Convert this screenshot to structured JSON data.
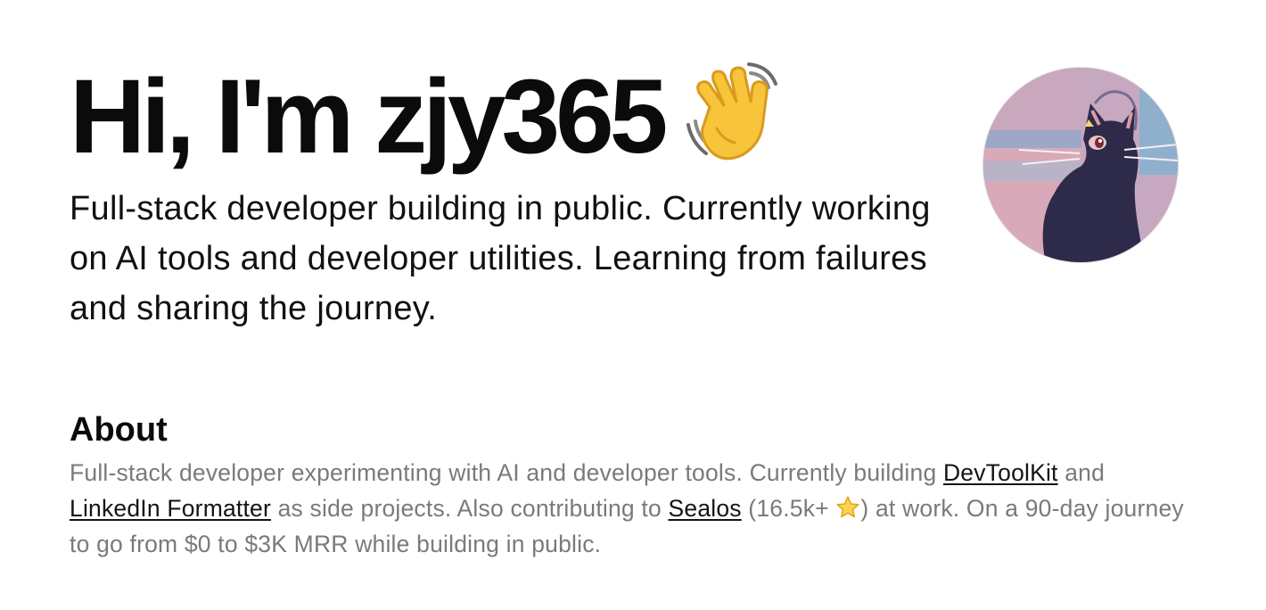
{
  "hero": {
    "title": "Hi, I'm zjy365",
    "wave_icon": "waving-hand-icon",
    "bio": "Full-stack developer building in public. Currently working on AI tools and developer utilities. Learning from failures and sharing the journey."
  },
  "avatar": {
    "alt": "avatar",
    "icon": "black-cat-avatar"
  },
  "about": {
    "heading": "About",
    "text_1": "Full-stack developer experimenting with AI and developer tools. Currently building ",
    "link_devtoolkit": "DevToolKit",
    "text_2": " and ",
    "link_linkedin": "LinkedIn Formatter",
    "text_3": " as side projects. Also contributing to ",
    "link_sealos": "Sealos",
    "text_4": " (16.5k+ ",
    "star_icon": "star-icon",
    "text_5": ") at work. On a 90-day journey to go from $0 to $3K MRR while building in public."
  },
  "colors": {
    "heading": "#0b0b0b",
    "body_text": "#111111",
    "muted_text": "#7a7a7a",
    "link": "#141414",
    "background": "#ffffff"
  }
}
